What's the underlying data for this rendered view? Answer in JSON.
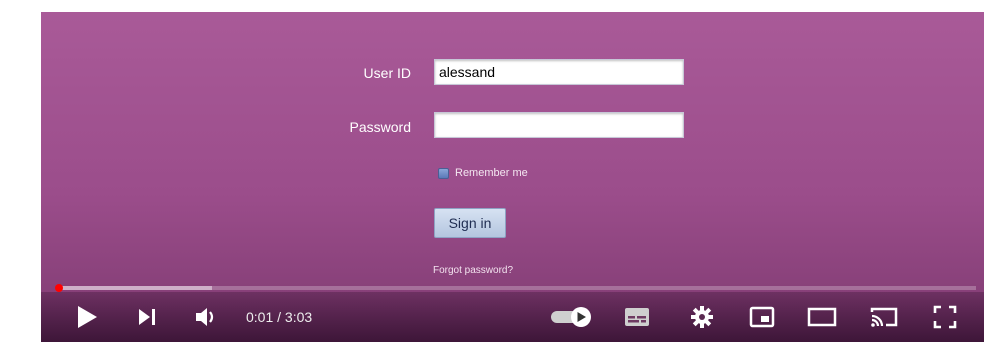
{
  "login": {
    "user_id_label": "User ID",
    "user_id_value": "alessand",
    "password_label": "Password",
    "password_value": "",
    "remember_label": "Remember me",
    "signin_label": "Sign in",
    "forgot_label": "Forgot password?"
  },
  "player": {
    "current_time": "0:01",
    "duration": "3:03",
    "time_display": "0:01 / 3:03",
    "played_fraction": 0.003,
    "buffered_fraction": 0.17,
    "autoplay": "on",
    "icons": [
      "play-icon",
      "next-icon",
      "volume-icon",
      "autoplay-toggle-icon",
      "subtitles-icon",
      "settings-icon",
      "miniplayer-icon",
      "theater-mode-icon",
      "cast-icon",
      "fullscreen-icon"
    ]
  },
  "colors": {
    "background_top": "#a95a98",
    "background_bottom": "#7e3a70",
    "progress_played": "#ff0000",
    "signin_button": "#c6d4ea"
  }
}
